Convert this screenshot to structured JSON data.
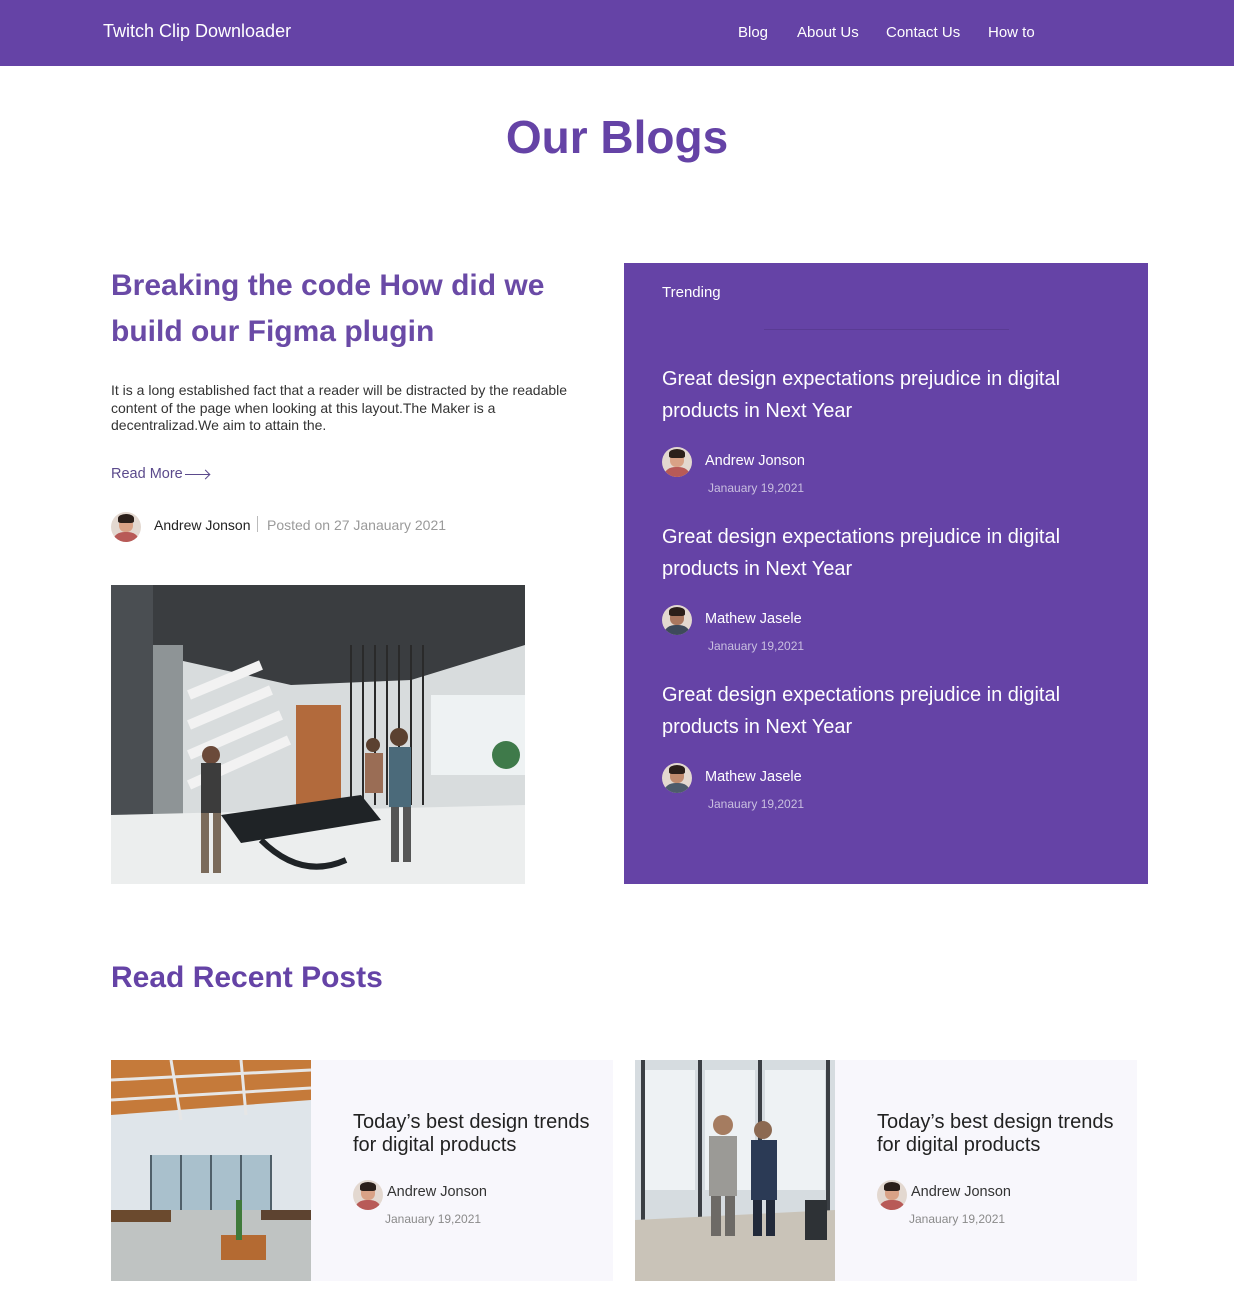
{
  "navbar": {
    "brand": "Twitch Clip Downloader",
    "links": [
      "Blog",
      "About Us",
      "Contact Us",
      "How to"
    ],
    "color": "#6543a6"
  },
  "page_title": "Our Blogs",
  "featured": {
    "title": "Breaking the code How did we build our Figma plugin",
    "excerpt": "It is a long established fact that a reader will be distracted by the readable content of the page when looking at this layout.The Maker is a decentralizad.We aim to attain the.",
    "read_more": "Read More",
    "author": "Andrew Jonson",
    "date": "Posted on 27 Janauary 2021",
    "image_icon": "office-photo"
  },
  "trending": {
    "label": "Trending",
    "items": [
      {
        "title": "Great design expectations prejudice in digital products in Next Year",
        "author": "Andrew Jonson",
        "date": "Janauary 19,2021"
      },
      {
        "title": "Great design expectations prejudice in digital products in Next Year",
        "author": "Mathew Jasele",
        "date": "Janauary 19,2021"
      },
      {
        "title": "Great design expectations prejudice in digital products in Next Year",
        "author": "Mathew Jasele",
        "date": "Janauary 19,2021"
      }
    ]
  },
  "recent": {
    "title": "Read Recent Posts",
    "posts": [
      {
        "title": "Today’s best design trends for digital products",
        "author": "Andrew Jonson",
        "date": "Janauary 19,2021",
        "image_icon": "office-interior-photo"
      },
      {
        "title": "Today’s best design trends for digital products",
        "author": "Andrew Jonson",
        "date": "Janauary 19,2021",
        "image_icon": "business-meeting-photo"
      }
    ]
  }
}
